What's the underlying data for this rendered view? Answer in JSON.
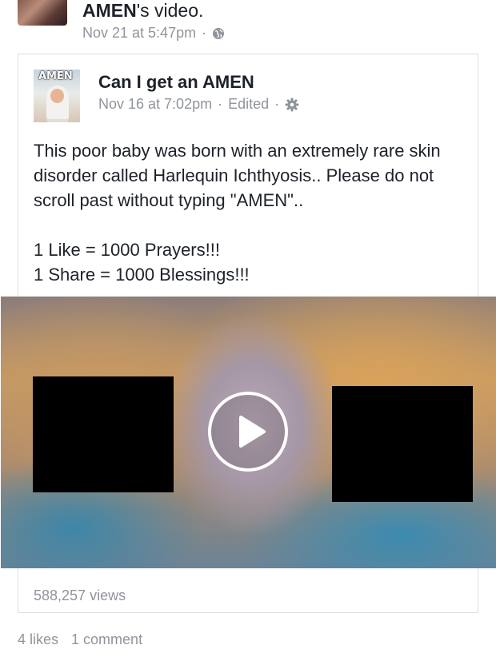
{
  "shared_by": {
    "page_name": "AMEN",
    "title_suffix": "'s video.",
    "timestamp": "Nov 21 at 5:47pm",
    "separator": "·",
    "privacy_icon": "globe-icon"
  },
  "post": {
    "avatar_badge": "AMEN",
    "page_name": "Can I get an AMEN",
    "timestamp": "Nov 16 at 7:02pm",
    "edited": "Edited",
    "separator": "·",
    "settings_icon": "gear-icon",
    "text_lines": [
      "This poor baby was born with an extremely rare skin disorder called Harlequin Ichthyosis.. Please do not scroll past without typing \"AMEN\"..",
      "1 Like = 1000 Prayers!!!",
      "1 Share = 1000 Blessings!!!"
    ],
    "video": {
      "play_icon": "play-icon",
      "views": "588,257 views"
    }
  },
  "engagement": {
    "likes": "4 likes",
    "comments": "1 comment"
  },
  "colors": {
    "text_primary": "#1d2129",
    "text_secondary": "#90949c",
    "border": "#dddfe2"
  }
}
